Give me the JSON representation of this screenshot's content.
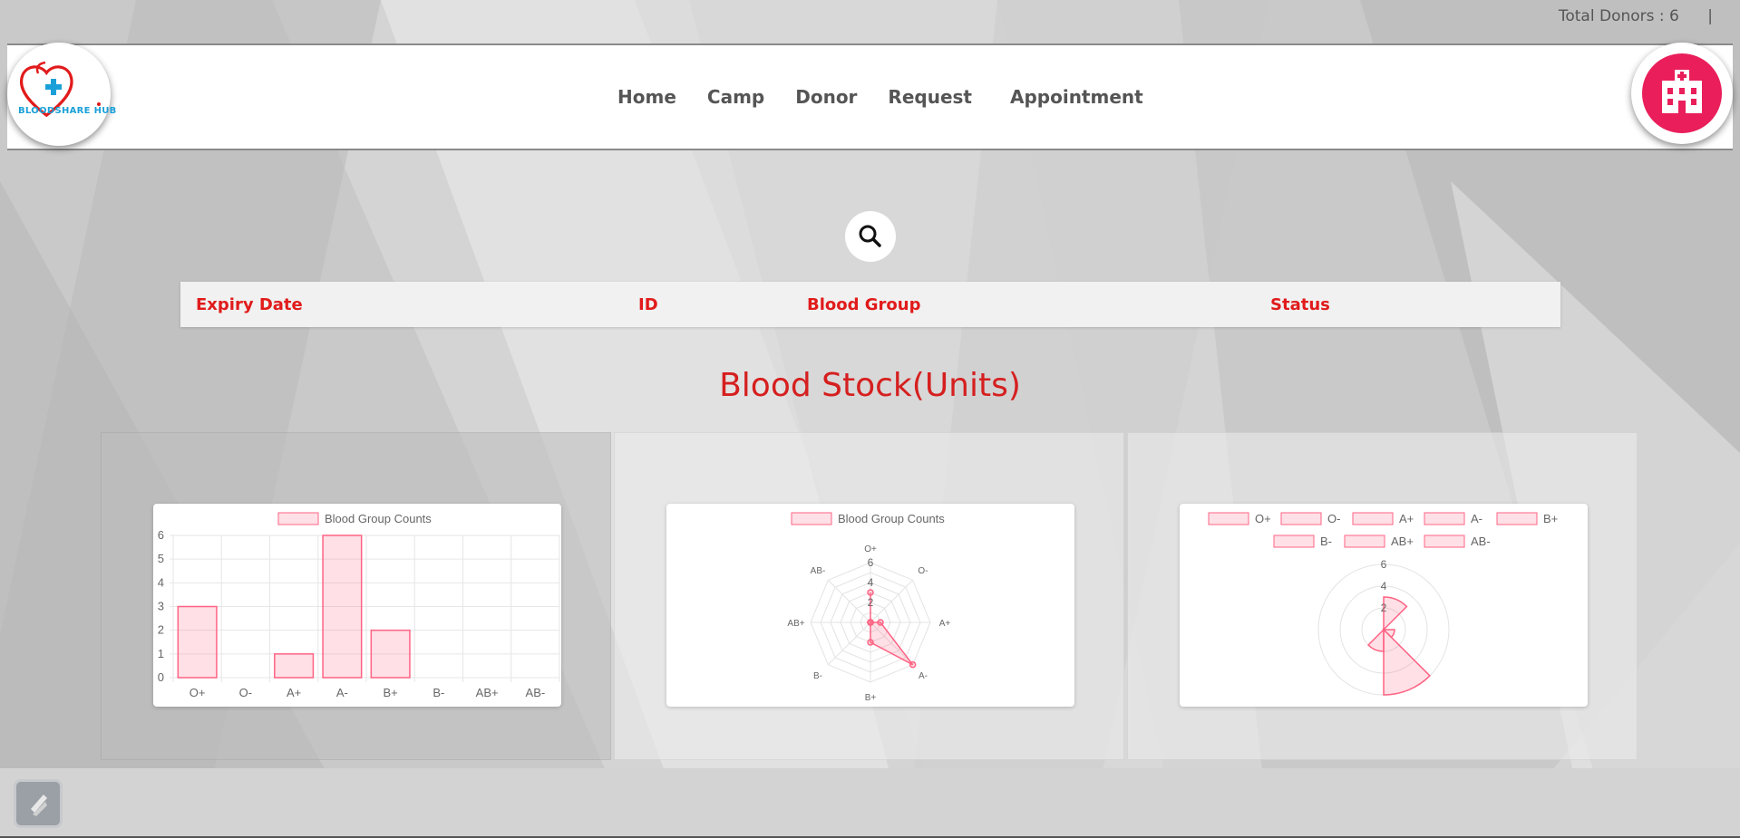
{
  "header": {
    "total_donors_label": "Total Donors : 6",
    "separator": "|"
  },
  "brand": {
    "logo_text": "BLOODSHARE HUB"
  },
  "nav": {
    "items": [
      "Home",
      "Camp",
      "Donor",
      "Request",
      "Appointment"
    ]
  },
  "table": {
    "columns": [
      "Expiry Date",
      "ID",
      "Blood Group",
      "Status"
    ]
  },
  "section": {
    "title": "Blood Stock(Units)"
  },
  "colors": {
    "accent_red": "#e11b1b",
    "chart_stroke": "#ff6384",
    "chart_fill": "rgba(255,99,132,0.2)",
    "hospital_button": "#e91e5a"
  },
  "icons": {
    "logo": "heart-cross-icon",
    "hospital": "hospital-icon",
    "search": "search-icon",
    "float": "lightning-icon"
  },
  "chart_data": [
    {
      "type": "bar",
      "legend": "Blood Group Counts",
      "categories": [
        "O+",
        "O-",
        "A+",
        "A-",
        "B+",
        "B-",
        "AB+",
        "AB-"
      ],
      "values": [
        3,
        0,
        1,
        6,
        2,
        0,
        0,
        0
      ],
      "ylim": [
        0,
        6
      ],
      "yticks": [
        "6",
        "5",
        "4",
        "3",
        "2",
        "1",
        "0"
      ]
    },
    {
      "type": "radar",
      "legend": "Blood Group Counts",
      "categories": [
        "O+",
        "O-",
        "A+",
        "A-",
        "B+",
        "B-",
        "AB+",
        "AB-"
      ],
      "values": [
        3,
        0,
        1,
        6,
        2,
        0,
        0,
        0
      ],
      "ticks": [
        "6",
        "4",
        "2"
      ]
    },
    {
      "type": "polarArea",
      "legend": [
        "O+",
        "O-",
        "A+",
        "A-",
        "B+",
        "B-",
        "AB+",
        "AB-"
      ],
      "values": [
        3,
        0,
        1,
        6,
        2,
        0,
        0,
        0
      ],
      "ticks": [
        "6",
        "4",
        "2"
      ]
    }
  ]
}
